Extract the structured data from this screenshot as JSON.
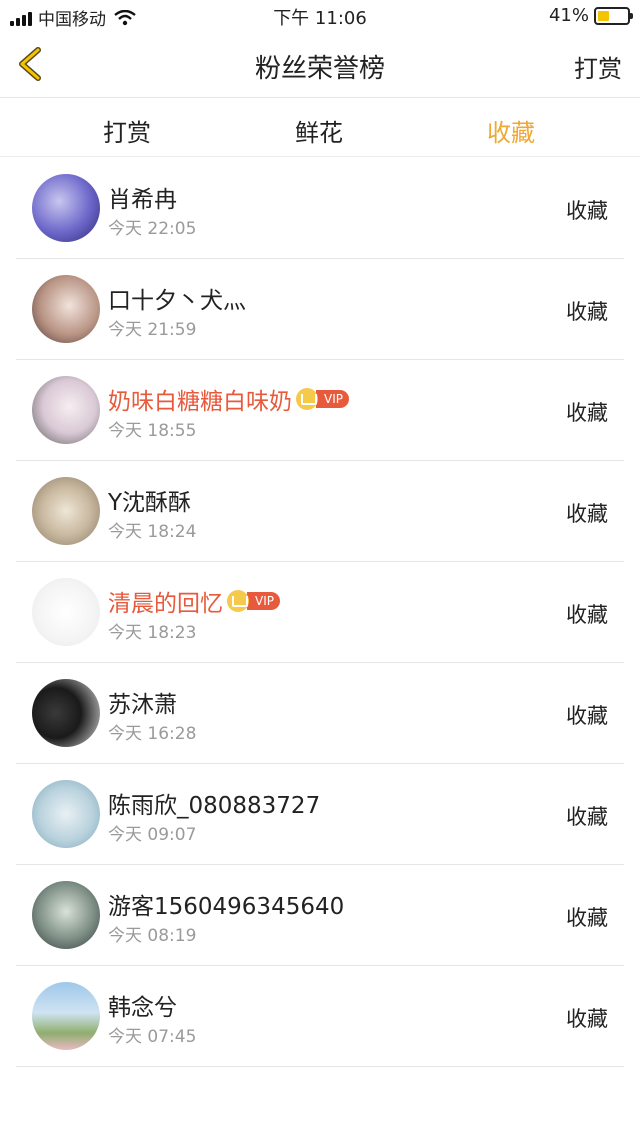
{
  "status": {
    "carrier": "中国移动",
    "time": "下午 11:06",
    "battery_pct": "41%",
    "battery_level": 0.41,
    "battery_color": "#f5c400"
  },
  "nav": {
    "back_icon": "chevron-left-icon",
    "title": "粉丝荣誉榜",
    "right_label": "打赏"
  },
  "tabs": [
    {
      "label": "打赏",
      "active": false
    },
    {
      "label": "鲜花",
      "active": false
    },
    {
      "label": "收藏",
      "active": true
    }
  ],
  "accent_color": "#f0a830",
  "vip_color": "#e85a3c",
  "fans": [
    {
      "name": "肖希冉",
      "time": "今天 22:05",
      "action": "收藏",
      "vip": false
    },
    {
      "name": "口十夕丶犬灬",
      "time": "今天 21:59",
      "action": "收藏",
      "vip": false
    },
    {
      "name": "奶味白糖糖白味奶",
      "time": "今天 18:55",
      "action": "收藏",
      "vip": true,
      "badge": "VIP"
    },
    {
      "name": "Y沈酥酥",
      "time": "今天 18:24",
      "action": "收藏",
      "vip": false
    },
    {
      "name": "清晨的回忆",
      "time": "今天 18:23",
      "action": "收藏",
      "vip": true,
      "badge": "VIP"
    },
    {
      "name": "苏沐萧",
      "time": "今天 16:28",
      "action": "收藏",
      "vip": false
    },
    {
      "name": "陈雨欣_080883727",
      "time": "今天 09:07",
      "action": "收藏",
      "vip": false
    },
    {
      "name": "游客1560496345640",
      "time": "今天 08:19",
      "action": "收藏",
      "vip": false
    },
    {
      "name": "韩念兮",
      "time": "今天 07:45",
      "action": "收藏",
      "vip": false
    }
  ]
}
